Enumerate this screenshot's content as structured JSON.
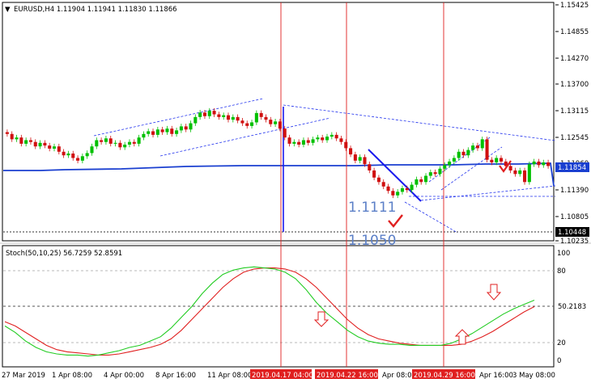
{
  "window": {
    "symbol_header": "EURUSD,H4  1.11904 1.11941 1.11830 1.11866",
    "stoch_header": "Stoch(50,10,25) 56.7259 52.8591"
  },
  "price_axis": {
    "ticks": [
      "1.15425",
      "1.14855",
      "1.14270",
      "1.13700",
      "1.13115",
      "1.12545",
      "1.11960",
      "1.11390",
      "1.10805",
      "1.10235"
    ],
    "ymin": 1.1018,
    "ymax": 1.1548,
    "current_tag": "1.11854",
    "support_tag": "1.10448"
  },
  "stoch_axis": {
    "ticks": [
      "100",
      "80",
      "20",
      "0"
    ],
    "current_tag": "50.2183"
  },
  "time_axis": {
    "labels": [
      "27 Mar 2019",
      "1 Apr 08:00",
      "4 Apr 00:00",
      "8 Apr 16:00",
      "11 Apr 08:00",
      "Apr 16:00",
      "Apr 08:00",
      "Apr 16:00",
      "3 May 08:00"
    ],
    "highlighted": [
      "2019.04.17 04:00",
      "2019.04.22 16:00",
      "2019.04.29 16:00"
    ]
  },
  "annotations": {
    "label_low1": "1.1111",
    "label_low2": "1.1050"
  },
  "colors": {
    "candle_up": "#00c000",
    "candle_down": "#d01010",
    "stoch_main": "#22cc22",
    "stoch_signal": "#e02020",
    "trend_blue": "#1a1aee",
    "vline_red": "#e02020",
    "ma_line": "#1a3fd0"
  },
  "chart_data": {
    "type": "candlestick",
    "ohlc_path": [
      [
        1.1262,
        1.1258
      ],
      [
        1.1258,
        1.1246
      ],
      [
        1.1246,
        1.125
      ],
      [
        1.125,
        1.1236
      ],
      [
        1.1236,
        1.1244
      ],
      [
        1.1244,
        1.124
      ],
      [
        1.124,
        1.123
      ],
      [
        1.123,
        1.1238
      ],
      [
        1.1238,
        1.1232
      ],
      [
        1.1232,
        1.1225
      ],
      [
        1.1225,
        1.123
      ],
      [
        1.123,
        1.1218
      ],
      [
        1.1218,
        1.121
      ],
      [
        1.121,
        1.1214
      ],
      [
        1.1214,
        1.1204
      ],
      [
        1.1204,
        1.1198
      ],
      [
        1.1198,
        1.1208
      ],
      [
        1.1208,
        1.1215
      ],
      [
        1.1215,
        1.123
      ],
      [
        1.123,
        1.1244
      ],
      [
        1.1244,
        1.124
      ],
      [
        1.124,
        1.1248
      ],
      [
        1.1248,
        1.1236
      ],
      [
        1.1236,
        1.1238
      ],
      [
        1.1238,
        1.1228
      ],
      [
        1.1228,
        1.1234
      ],
      [
        1.1234,
        1.124
      ],
      [
        1.124,
        1.1236
      ],
      [
        1.1236,
        1.125
      ],
      [
        1.125,
        1.1258
      ],
      [
        1.1258,
        1.1264
      ],
      [
        1.1264,
        1.1256
      ],
      [
        1.1256,
        1.1268
      ],
      [
        1.1268,
        1.1262
      ],
      [
        1.1262,
        1.127
      ],
      [
        1.127,
        1.1258
      ],
      [
        1.1258,
        1.1266
      ],
      [
        1.1266,
        1.1275
      ],
      [
        1.1275,
        1.1268
      ],
      [
        1.1268,
        1.1282
      ],
      [
        1.1282,
        1.1296
      ],
      [
        1.1296,
        1.1306
      ],
      [
        1.1306,
        1.1298
      ],
      [
        1.1298,
        1.131
      ],
      [
        1.131,
        1.1302
      ],
      [
        1.1302,
        1.1296
      ],
      [
        1.1296,
        1.13
      ],
      [
        1.13,
        1.129
      ],
      [
        1.129,
        1.1296
      ],
      [
        1.1296,
        1.1288
      ],
      [
        1.1288,
        1.1282
      ],
      [
        1.1282,
        1.1276
      ],
      [
        1.1276,
        1.1284
      ],
      [
        1.1284,
        1.1305
      ],
      [
        1.1305,
        1.1296
      ],
      [
        1.1296,
        1.129
      ],
      [
        1.129,
        1.128
      ],
      [
        1.128,
        1.1286
      ],
      [
        1.1286,
        1.127
      ],
      [
        1.127,
        1.125
      ],
      [
        1.125,
        1.1236
      ],
      [
        1.1236,
        1.124
      ],
      [
        1.124,
        1.1234
      ],
      [
        1.1234,
        1.1244
      ],
      [
        1.1244,
        1.1238
      ],
      [
        1.1238,
        1.1246
      ],
      [
        1.1246,
        1.125
      ],
      [
        1.125,
        1.1244
      ],
      [
        1.1244,
        1.1252
      ],
      [
        1.1252,
        1.1256
      ],
      [
        1.1256,
        1.1248
      ],
      [
        1.1248,
        1.124
      ],
      [
        1.124,
        1.1226
      ],
      [
        1.1226,
        1.1212
      ],
      [
        1.1212,
        1.1198
      ],
      [
        1.1198,
        1.1206
      ],
      [
        1.1206,
        1.119
      ],
      [
        1.119,
        1.1176
      ],
      [
        1.1176,
        1.116
      ],
      [
        1.116,
        1.115
      ],
      [
        1.115,
        1.114
      ],
      [
        1.114,
        1.113
      ],
      [
        1.113,
        1.112
      ],
      [
        1.112,
        1.1128
      ],
      [
        1.1128,
        1.1136
      ],
      [
        1.1136,
        1.1132
      ],
      [
        1.1132,
        1.1144
      ],
      [
        1.1144,
        1.1156
      ],
      [
        1.1156,
        1.115
      ],
      [
        1.115,
        1.1164
      ],
      [
        1.1164,
        1.1172
      ],
      [
        1.1172,
        1.1168
      ],
      [
        1.1168,
        1.118
      ],
      [
        1.118,
        1.1188
      ],
      [
        1.1188,
        1.1196
      ],
      [
        1.1196,
        1.1204
      ],
      [
        1.1204,
        1.1218
      ],
      [
        1.1218,
        1.121
      ],
      [
        1.121,
        1.1222
      ],
      [
        1.1222,
        1.1232
      ],
      [
        1.1232,
        1.1226
      ],
      [
        1.1226,
        1.1246
      ],
      [
        1.1246,
        1.12
      ],
      [
        1.12,
        1.1194
      ],
      [
        1.1194,
        1.1204
      ],
      [
        1.1204,
        1.1196
      ],
      [
        1.1196,
        1.1186
      ],
      [
        1.1186,
        1.1176
      ],
      [
        1.1176,
        1.1168
      ],
      [
        1.1168,
        1.1176
      ],
      [
        1.1176,
        1.115
      ],
      [
        1.115,
        1.119
      ],
      [
        1.119,
        1.1196
      ],
      [
        1.1196,
        1.1188
      ],
      [
        1.1188,
        1.1194
      ],
      [
        1.1194,
        1.1186
      ]
    ],
    "stoch_main": [
      32,
      26,
      18,
      12,
      8,
      6,
      5,
      5,
      4,
      5,
      7,
      9,
      12,
      14,
      18,
      22,
      30,
      40,
      50,
      62,
      72,
      80,
      84,
      86,
      87,
      86,
      85,
      82,
      76,
      66,
      54,
      44,
      36,
      28,
      22,
      18,
      16,
      15,
      15,
      14,
      14,
      14,
      14,
      16,
      20,
      25,
      31,
      37,
      43,
      48,
      52,
      56
    ],
    "stoch_signal": [
      36,
      32,
      26,
      20,
      14,
      10,
      8,
      7,
      6,
      5,
      5,
      6,
      8,
      10,
      12,
      15,
      20,
      28,
      38,
      48,
      58,
      68,
      76,
      82,
      85,
      86,
      86,
      85,
      82,
      76,
      68,
      58,
      48,
      38,
      30,
      24,
      20,
      18,
      16,
      15,
      14,
      14,
      14,
      14,
      15,
      18,
      22,
      27,
      33,
      39,
      45,
      50
    ]
  }
}
